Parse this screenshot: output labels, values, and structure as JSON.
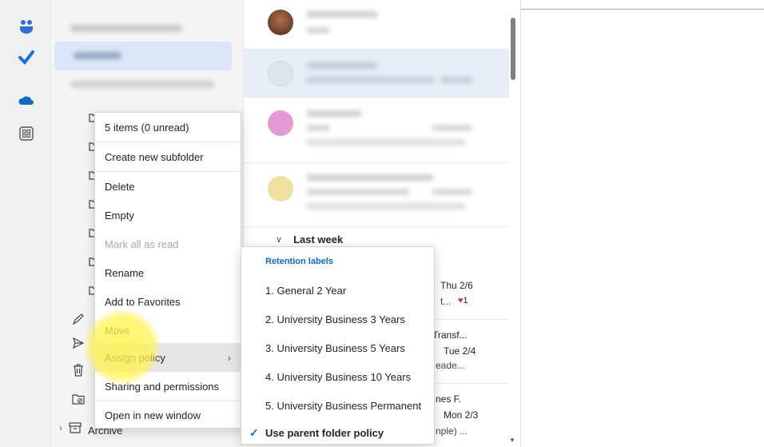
{
  "colors": {
    "accent": "#0f6cbd",
    "selected_row": "#e8eef8",
    "heart": "#d13438",
    "highlight": "#fff350"
  },
  "rail": {
    "icons": [
      "teams-icon",
      "todo-check-icon",
      "onedrive-cloud-icon",
      "apps-grid-icon"
    ]
  },
  "folder_pane": {
    "archive_label": "Archive"
  },
  "message_list": {
    "group_header": "Last week",
    "rows": [
      {
        "date": "Thu 2/6",
        "preview": "t...",
        "reactions": "1"
      },
      {
        "subject": "Transf...",
        "date": "Tue 2/4",
        "preview": "eade..."
      },
      {
        "sender": "nes F.",
        "date": "Mon 2/3",
        "preview": "nple) ..."
      }
    ]
  },
  "context_menu": {
    "summary": "5 items (0 unread)",
    "create_subfolder": "Create new subfolder",
    "delete": "Delete",
    "empty": "Empty",
    "mark_all_read": "Mark all as read",
    "rename": "Rename",
    "add_favorites": "Add to Favorites",
    "move": "Move",
    "assign_policy": "Assign policy",
    "sharing": "Sharing and permissions",
    "open_new_window": "Open in new window"
  },
  "submenu": {
    "header": "Retention labels",
    "items": [
      "1. General 2 Year",
      "2. University Business 3 Years",
      "3. University Business 5 Years",
      "4. University Business 10 Years",
      "5. University Business Permanent",
      "Use parent folder policy"
    ],
    "checked_index": 5
  }
}
